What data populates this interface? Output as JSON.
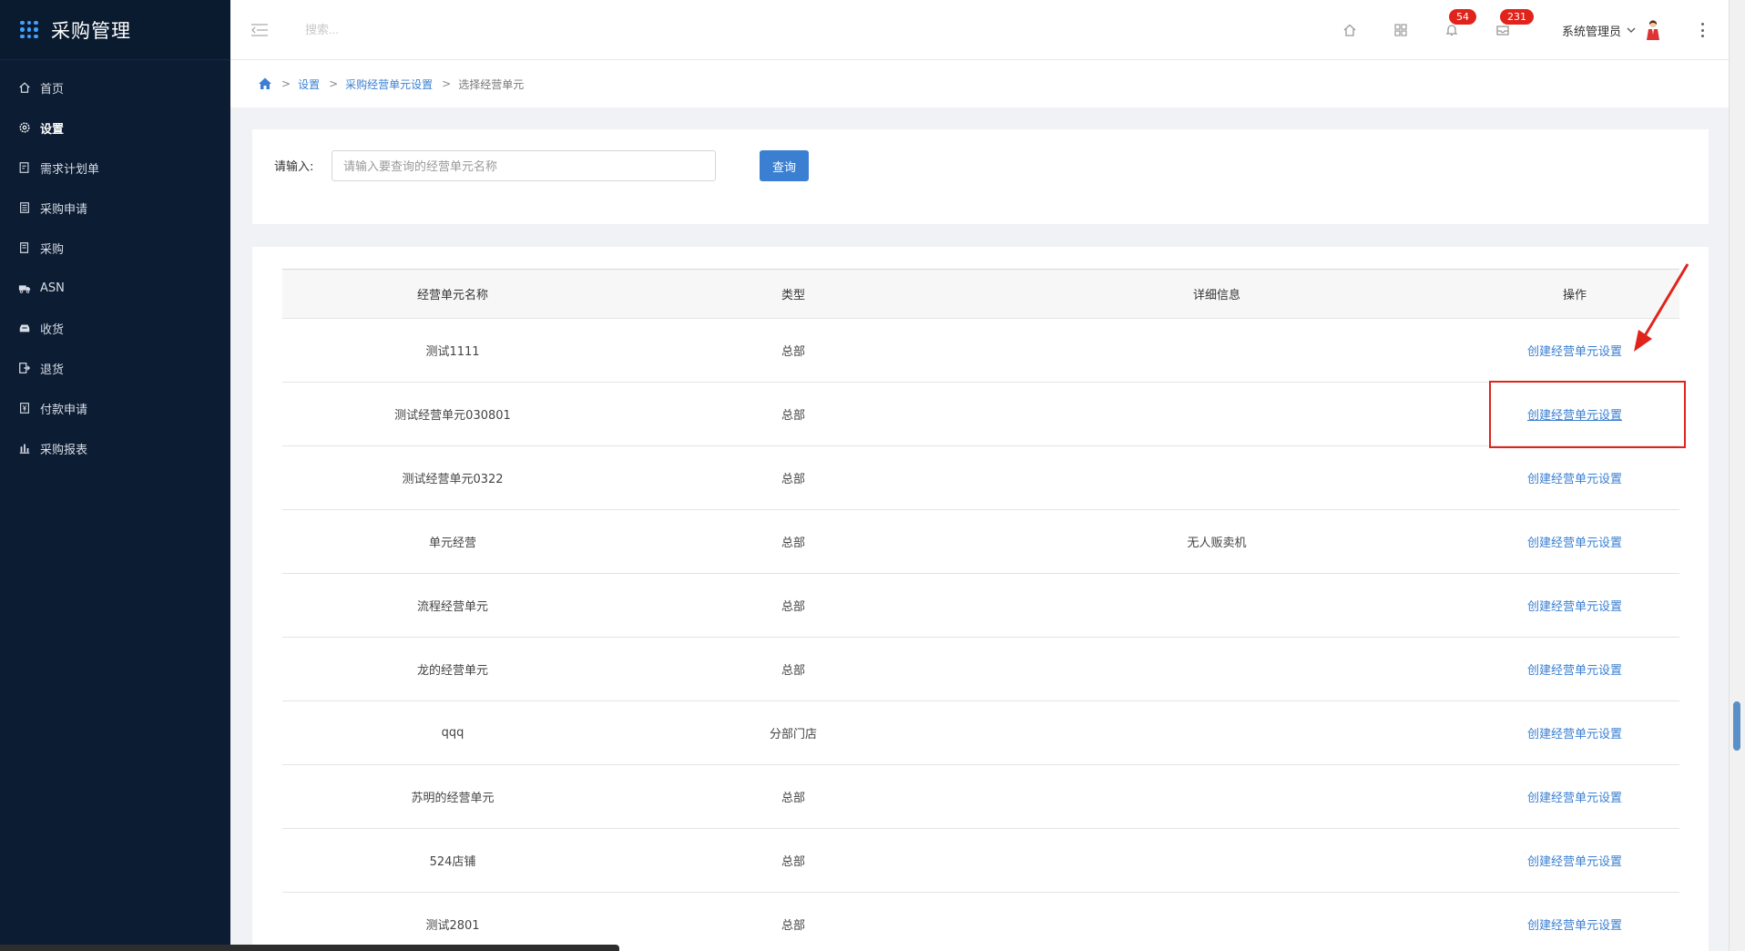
{
  "app": {
    "title": "采购管理"
  },
  "sidebar": {
    "items": [
      {
        "label": "首页",
        "icon": "home-icon",
        "active": false
      },
      {
        "label": "设置",
        "icon": "gear-icon",
        "active": true
      },
      {
        "label": "需求计划单",
        "icon": "document-edit-icon",
        "active": false
      },
      {
        "label": "采购申请",
        "icon": "clipboard-icon",
        "active": false
      },
      {
        "label": "采购",
        "icon": "receipt-icon",
        "active": false
      },
      {
        "label": "ASN",
        "icon": "truck-icon",
        "active": false
      },
      {
        "label": "收货",
        "icon": "inbox-icon",
        "active": false
      },
      {
        "label": "退货",
        "icon": "return-icon",
        "active": false
      },
      {
        "label": "付款申请",
        "icon": "payment-icon",
        "active": false
      },
      {
        "label": "采购报表",
        "icon": "bar-chart-icon",
        "active": false
      }
    ]
  },
  "header": {
    "search_placeholder": "搜索...",
    "notifications_count": "54",
    "messages_count": "231",
    "user_name": "系统管理员"
  },
  "breadcrumb": {
    "items": [
      "设置",
      "采购经营单元设置"
    ],
    "current": "选择经营单元",
    "separator": ">"
  },
  "search": {
    "label": "请输入:",
    "placeholder": "请输入要查询的经营单元名称",
    "value": "",
    "button_label": "查询"
  },
  "table": {
    "columns": [
      "经营单元名称",
      "类型",
      "详细信息",
      "操作"
    ],
    "rows": [
      {
        "name": "测试1111",
        "type": "总部",
        "detail": "",
        "action": "创建经营单元设置"
      },
      {
        "name": "测试经营单元030801",
        "type": "总部",
        "detail": "",
        "action": "创建经营单元设置"
      },
      {
        "name": "测试经营单元0322",
        "type": "总部",
        "detail": "",
        "action": "创建经营单元设置"
      },
      {
        "name": "单元经营",
        "type": "总部",
        "detail": "无人贩卖机",
        "action": "创建经营单元设置"
      },
      {
        "name": "流程经营单元",
        "type": "总部",
        "detail": "",
        "action": "创建经营单元设置"
      },
      {
        "name": "龙的经营单元",
        "type": "总部",
        "detail": "",
        "action": "创建经营单元设置"
      },
      {
        "name": "qqq",
        "type": "分部门店",
        "detail": "",
        "action": "创建经营单元设置"
      },
      {
        "name": "苏明的经营单元",
        "type": "总部",
        "detail": "",
        "action": "创建经营单元设置"
      },
      {
        "name": "524店铺",
        "type": "总部",
        "detail": "",
        "action": "创建经营单元设置"
      },
      {
        "name": "测试2801",
        "type": "总部",
        "detail": "",
        "action": "创建经营单元设置"
      }
    ]
  },
  "colors": {
    "sidebar_bg": "#0c1c33",
    "accent": "#3a7fd1",
    "badge": "#e1241b",
    "annotation": "#e0241b"
  }
}
